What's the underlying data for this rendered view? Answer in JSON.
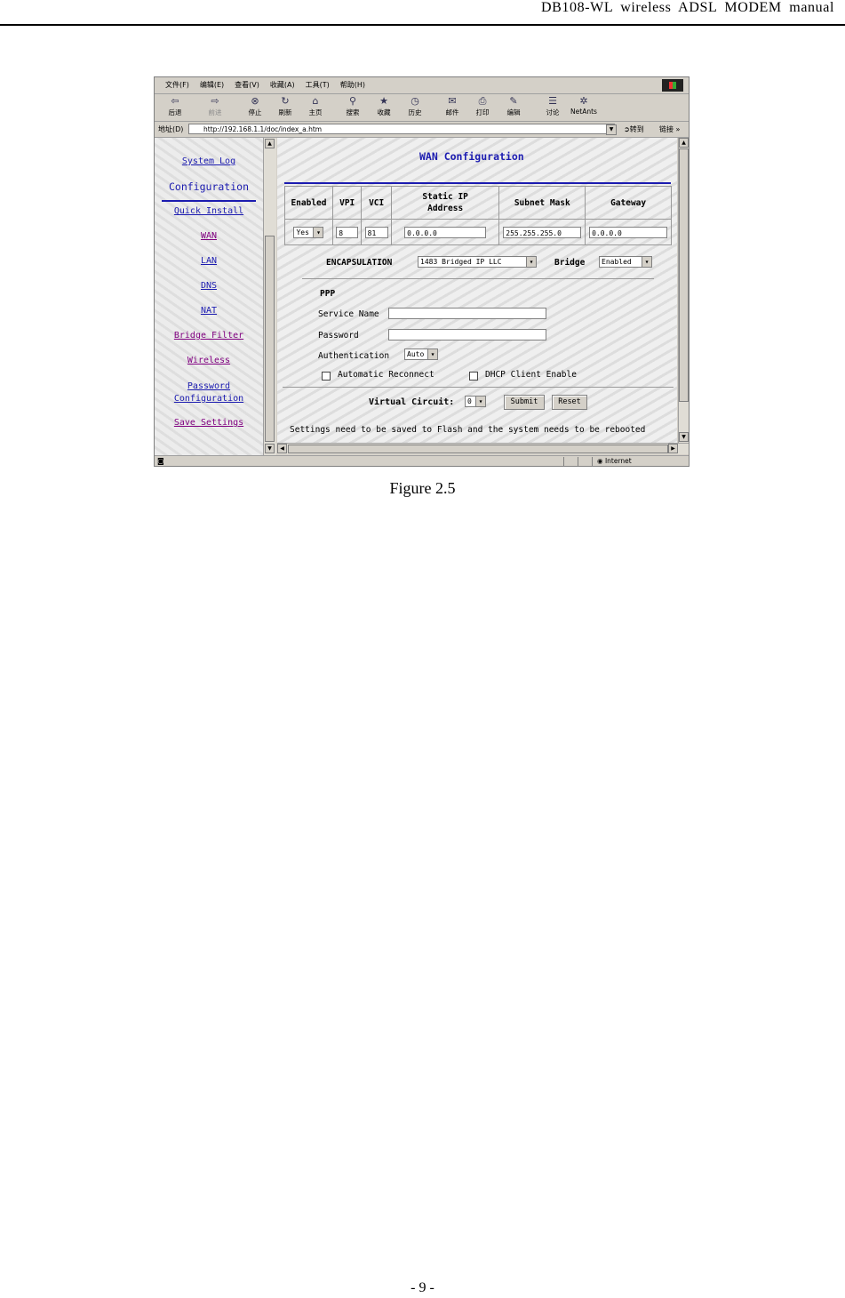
{
  "header": {
    "title": "DB108-WL  wireless  ADSL  MODEM  manual"
  },
  "browser": {
    "menu": [
      "文件(F)",
      "编辑(E)",
      "查看(V)",
      "收藏(A)",
      "工具(T)",
      "帮助(H)"
    ],
    "toolbar": {
      "back": "后退",
      "forward": "前进",
      "stop": "停止",
      "refresh": "刷新",
      "home": "主页",
      "search": "搜索",
      "favorites": "收藏",
      "history": "历史",
      "mail": "邮件",
      "print": "打印",
      "edit": "编辑",
      "discuss": "讨论",
      "netants": "NetAnts"
    },
    "address": {
      "label": "地址(D)",
      "url": "http://192.168.1.1/doc/index_a.htm",
      "go": "转到",
      "links": "链接 »"
    },
    "status": {
      "zone": "Internet"
    }
  },
  "sidebar": {
    "system_log": "System Log",
    "heading": "Configuration",
    "items": [
      "Quick Install",
      "WAN",
      "LAN",
      "DNS",
      "NAT",
      "Bridge Filter",
      "Wireless",
      "Password Configuration",
      "Save Settings"
    ]
  },
  "wan": {
    "title": "WAN Configuration",
    "columns": [
      "Enabled",
      "VPI",
      "VCI",
      "Static IP Address",
      "Subnet Mask",
      "Gateway"
    ],
    "row": {
      "enabled": "Yes",
      "vpi": "8",
      "vci": "81",
      "ip": "0.0.0.0",
      "mask": "255.255.255.0",
      "gateway": "0.0.0.0"
    },
    "encapsulation_label": "ENCAPSULATION",
    "encapsulation_value": "1483 Bridged IP LLC",
    "bridge_label": "Bridge",
    "bridge_value": "Enabled",
    "ppp_label": "PPP",
    "service_name_label": "Service Name",
    "password_label": "Password",
    "authentication_label": "Authentication",
    "authentication_value": "Auto",
    "auto_reconnect_label": "Automatic Reconnect",
    "dhcp_label": "DHCP Client Enable",
    "virtual_circuit_label": "Virtual Circuit:",
    "virtual_circuit_value": "0",
    "submit": "Submit",
    "reset": "Reset",
    "note": "Settings need to be saved to Flash and the system needs to be rebooted"
  },
  "caption": "Figure 2.5",
  "footer": "- 9 -"
}
